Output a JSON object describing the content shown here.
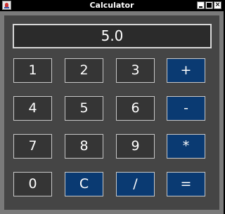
{
  "window": {
    "title": "Calculator",
    "controls": [
      "minimize",
      "maximize",
      "close"
    ]
  },
  "display": {
    "value": "5.0"
  },
  "keypad": {
    "rows": [
      [
        "1",
        "2",
        "3",
        "+"
      ],
      [
        "4",
        "5",
        "6",
        "-"
      ],
      [
        "7",
        "8",
        "9",
        "*"
      ],
      [
        "0",
        "C",
        "/",
        "="
      ]
    ]
  },
  "colors": {
    "window_background": "#000000",
    "frame": "#7a7a7a",
    "panel": "#454545",
    "digit_key": "#353535",
    "operator_key": "#0a3a72",
    "key_border": "#c8c8c8",
    "text": "#ffffff"
  },
  "icons": {
    "app": "java-app-icon",
    "minimize": "minimize-icon",
    "maximize": "maximize-icon",
    "close": "close-icon"
  }
}
